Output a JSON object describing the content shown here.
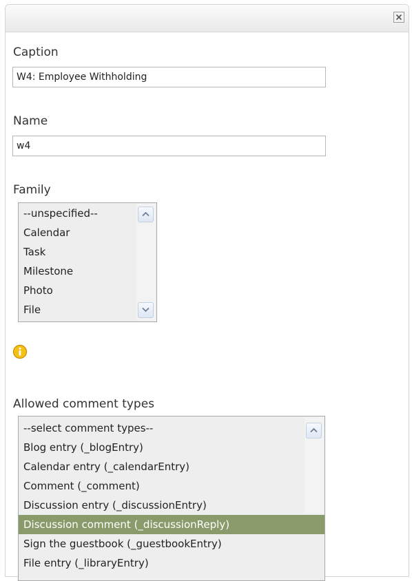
{
  "icons": {
    "close": "close-icon",
    "info": "info-icon",
    "scroll_up": "chevron-up-icon",
    "scroll_down": "chevron-down-icon"
  },
  "colors": {
    "selected_row": "#8a9b6b",
    "info_icon": "#f1b90d",
    "titlebar": "#efefef"
  },
  "caption": {
    "label": "Caption",
    "value": "W4: Employee Withholding"
  },
  "name": {
    "label": "Name",
    "value": "w4"
  },
  "family": {
    "label": "Family",
    "options": [
      "--unspecified--",
      "Calendar",
      "Task",
      "Milestone",
      "Photo",
      "File"
    ]
  },
  "comment_types": {
    "label": "Allowed comment types",
    "options": [
      "--select comment types--",
      "Blog entry (_blogEntry)",
      "Calendar entry (_calendarEntry)",
      "Comment (_comment)",
      "Discussion entry (_discussionEntry)",
      "Discussion comment (_discussionReply)",
      "Sign the guestbook (_guestbookEntry)",
      "File entry (_libraryEntry)"
    ],
    "selected": "Discussion comment (_discussionReply)"
  }
}
